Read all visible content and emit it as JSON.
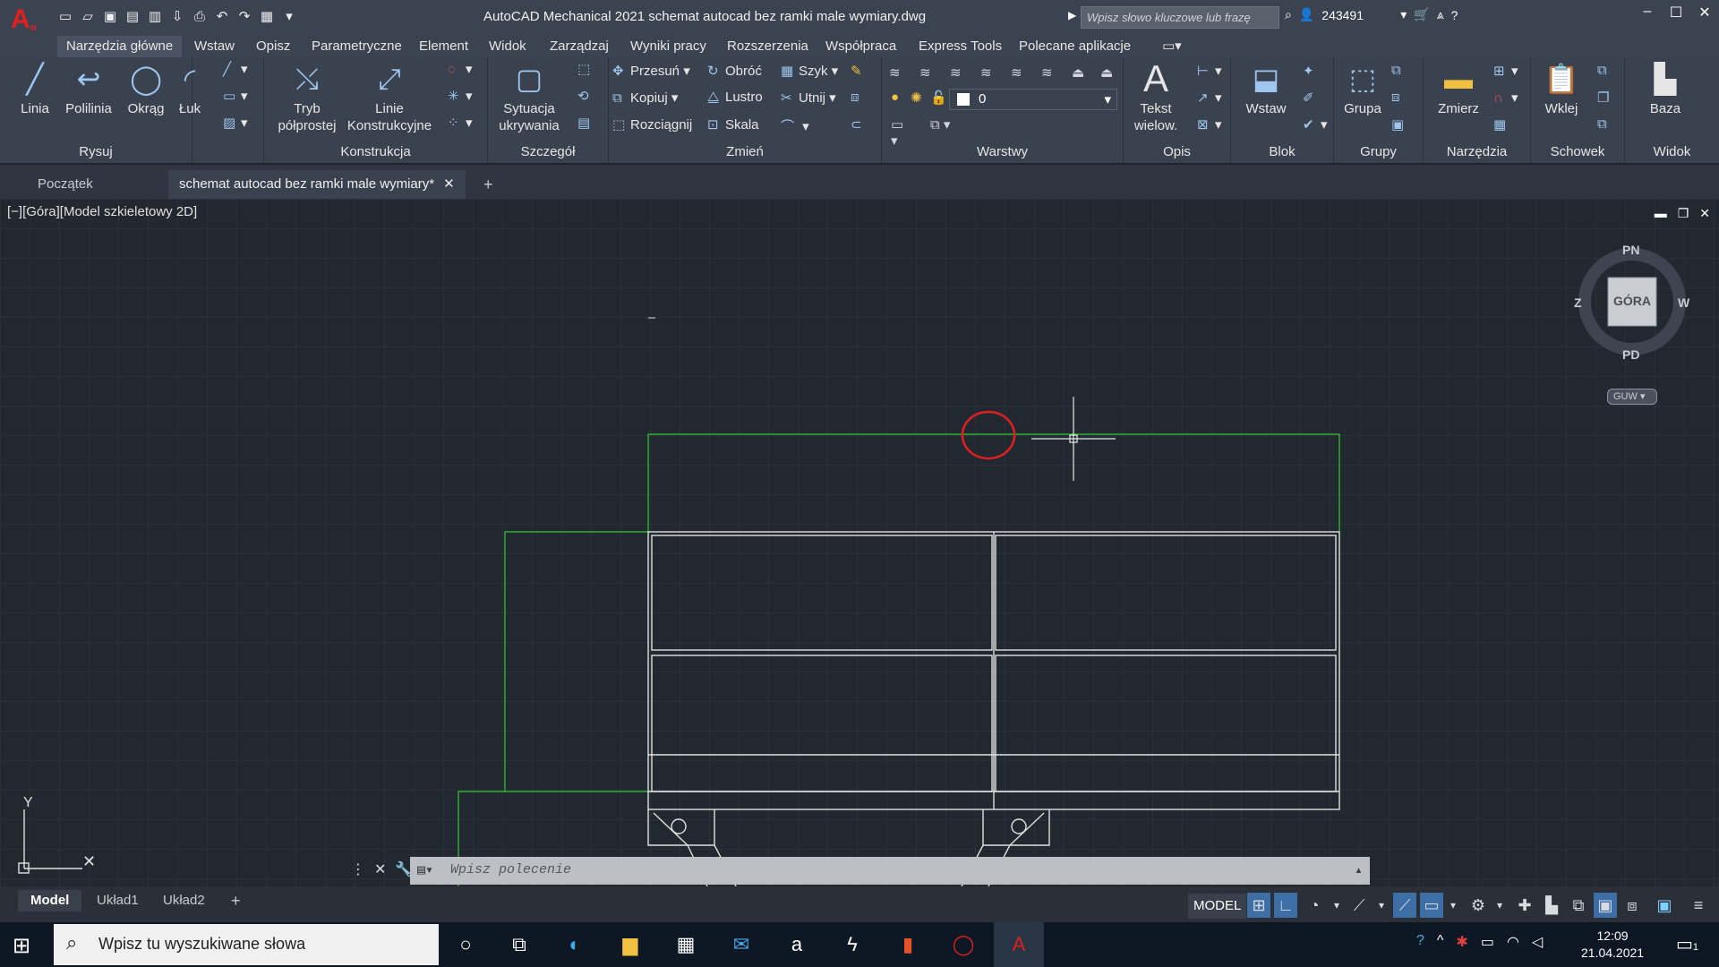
{
  "titlebar": {
    "app_title": "AutoCAD Mechanical 2021    schemat autocad bez ramki male wymiary.dwg",
    "search_placeholder": "Wpisz słowo kluczowe lub frazę",
    "user": "243491",
    "qat_icons": [
      "new-icon",
      "open-icon",
      "save-icon",
      "save-as-icon",
      "publish-icon",
      "import-icon",
      "print-icon",
      "undo-icon",
      "redo-icon",
      "workspace-icon",
      "customize-icon"
    ]
  },
  "ribbon_tabs": [
    "Narzędzia główne",
    "Wstaw",
    "Opisz",
    "Parametryczne",
    "Element",
    "Widok",
    "Zarządzaj",
    "Wyniki pracy",
    "Rozszerzenia",
    "Współpraca",
    "Express Tools",
    "Polecane aplikacje"
  ],
  "ribbon": {
    "rysuj": {
      "label": "Rysuj",
      "linia": "Linia",
      "polilinia": "Polilinia",
      "okrag": "Okrąg",
      "luk": "Łuk"
    },
    "konstrukcja": {
      "label": "Konstrukcja",
      "tryb1": "Tryb",
      "tryb2": "półprostej",
      "linie1": "Linie",
      "linie2": "Konstrukcyjne"
    },
    "szczegol": {
      "label": "Szczegół",
      "syt1": "Sytuacja",
      "syt2": "ukrywania"
    },
    "zmien": {
      "label": "Zmień",
      "przesun": "Przesuń",
      "obroc": "Obróć",
      "szyk": "Szyk",
      "kopiuj": "Kopiuj",
      "lustro": "Lustro",
      "utnij": "Utnij",
      "rozciagnij": "Rozciągnij",
      "skala": "Skala"
    },
    "warstwy": {
      "label": "Warstwy",
      "current_layer": "0"
    },
    "opis": {
      "label": "Opis",
      "tekst1": "Tekst",
      "tekst2": "wielow."
    },
    "blok": {
      "label": "Blok",
      "wstaw": "Wstaw"
    },
    "grupy": {
      "label": "Grupy",
      "grupa": "Grupa"
    },
    "narzedzia": {
      "label": "Narzędzia",
      "zmierz": "Zmierz"
    },
    "schowek": {
      "label": "Schowek",
      "wklej": "Wklej"
    },
    "widok": {
      "label": "Widok",
      "baza": "Baza"
    }
  },
  "doc_tabs": {
    "start": "Początek",
    "drawing": "schemat autocad bez ramki male wymiary*"
  },
  "viewport": {
    "label": "[−][Góra][Model szkieletowy 2D]",
    "viewcube": {
      "n": "PN",
      "s": "PD",
      "w": "Z",
      "e": "W",
      "face": "GÓRA",
      "ucs": "GUW"
    }
  },
  "command": {
    "placeholder": "Wpisz polecenie"
  },
  "layouts": [
    "Model",
    "Układ1",
    "Układ2"
  ],
  "status": {
    "model": "MODEL"
  },
  "taskbar": {
    "search_placeholder": "Wpisz tu wyszukiwane słowa",
    "time": "12:09",
    "date": "21.04.2021",
    "notifications": "1"
  },
  "colors": {
    "accent": "#3d6fa6",
    "green_line": "#32c832",
    "red_mark": "#e02020",
    "canvas": "#212830"
  }
}
